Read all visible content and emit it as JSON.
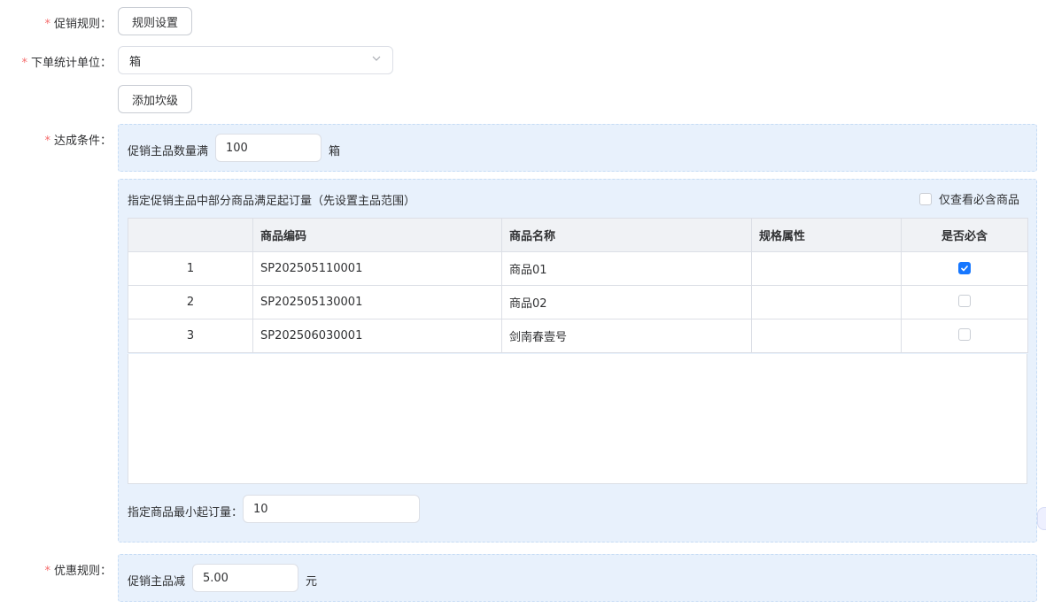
{
  "promo_rule": {
    "label": "促销规则",
    "button": "规则设置"
  },
  "order_unit": {
    "label": "下单统计单位",
    "value": "箱"
  },
  "add_level_button": "添加坎级",
  "condition": {
    "label": "达成条件",
    "prefix": "促销主品数量满",
    "qty": "100",
    "unit": "箱"
  },
  "designated": {
    "title": "指定促销主品中部分商品满足起订量（先设置主品范围）",
    "only_required_label": "仅查看必含商品",
    "columns": [
      "",
      "商品编码",
      "商品名称",
      "规格属性",
      "是否必含"
    ],
    "rows": [
      {
        "index": "1",
        "code": "SP202505110001",
        "name": "商品01",
        "spec": "",
        "required": true
      },
      {
        "index": "2",
        "code": "SP202505130001",
        "name": "商品02",
        "spec": "",
        "required": false
      },
      {
        "index": "3",
        "code": "SP202506030001",
        "name": "剑南春壹号",
        "spec": "",
        "required": false
      }
    ],
    "min_qty_label": "指定商品最小起订量：",
    "min_qty_value": "10"
  },
  "discount": {
    "label": "优惠规则",
    "prefix": "促销主品减",
    "value": "5.00",
    "unit": "元"
  },
  "colors": {
    "accent": "#1677ff",
    "required_star": "#f56c6c",
    "panel_bg": "#e8f1fc"
  }
}
